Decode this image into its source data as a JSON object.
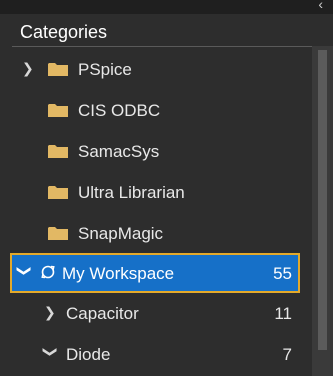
{
  "panel": {
    "title": "Categories"
  },
  "categories": [
    {
      "label": "PSpice",
      "expanded": false,
      "has_chevron": true,
      "icon": "folder-icon"
    },
    {
      "label": "CIS ODBC",
      "icon": "folder-icon"
    },
    {
      "label": "SamacSys",
      "icon": "folder-icon"
    },
    {
      "label": "Ultra Librarian",
      "icon": "folder-icon"
    },
    {
      "label": "SnapMagic",
      "icon": "folder-icon"
    }
  ],
  "workspace": {
    "label": "My Workspace",
    "count": "55",
    "expanded": true,
    "icon": "sync-icon",
    "children": [
      {
        "label": "Capacitor",
        "count": "11",
        "expanded": false
      },
      {
        "label": "Diode",
        "count": "7",
        "expanded": true
      }
    ]
  },
  "colors": {
    "selection": "#1670c8",
    "highlight_border": "#e3a92a",
    "folder": "#e2b864",
    "background": "#2d2d2d"
  }
}
